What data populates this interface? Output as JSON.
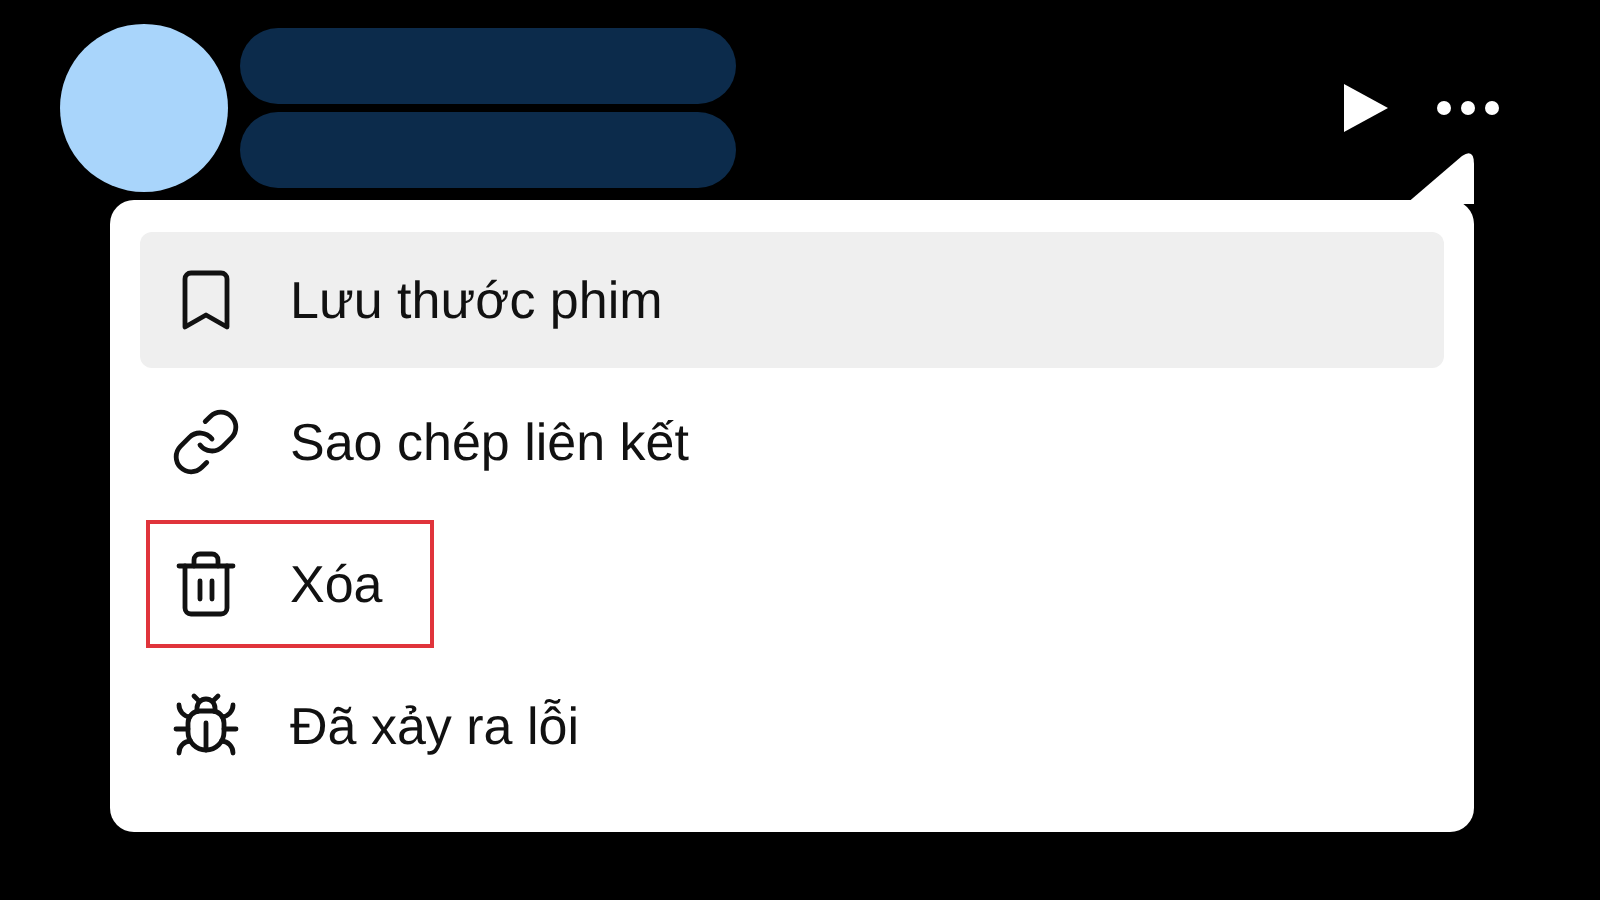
{
  "menu": {
    "items": [
      {
        "kind": "bookmark",
        "label": "Lưu thước phim",
        "selected": true,
        "outlined": false
      },
      {
        "kind": "link",
        "label": "Sao chép liên kết",
        "selected": false,
        "outlined": false
      },
      {
        "kind": "trash",
        "label": "Xóa",
        "selected": false,
        "outlined": true
      },
      {
        "kind": "bug",
        "label": "Đã xảy ra lỗi",
        "selected": false,
        "outlined": false
      }
    ]
  }
}
